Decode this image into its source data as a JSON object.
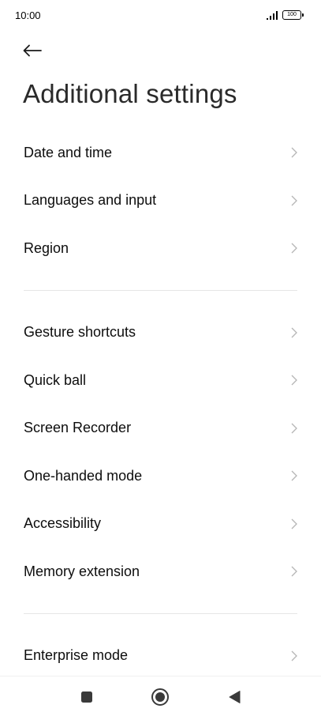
{
  "status_bar": {
    "time": "10:00",
    "battery": "100",
    "signal_icon": "signal-bars-icon",
    "battery_icon": "battery-icon"
  },
  "header": {
    "back_icon": "arrow-left-icon",
    "title": "Additional settings"
  },
  "groups": [
    {
      "items": [
        {
          "label": "Date and time"
        },
        {
          "label": "Languages and input"
        },
        {
          "label": "Region"
        }
      ]
    },
    {
      "items": [
        {
          "label": "Gesture shortcuts"
        },
        {
          "label": "Quick ball"
        },
        {
          "label": "Screen Recorder"
        },
        {
          "label": "One-handed mode"
        },
        {
          "label": "Accessibility"
        },
        {
          "label": "Memory extension"
        }
      ]
    },
    {
      "items": [
        {
          "label": "Enterprise mode"
        }
      ]
    }
  ],
  "nav_bar": {
    "recents_icon": "square-icon",
    "home_icon": "circle-icon",
    "back_icon": "triangle-back-icon"
  },
  "colors": {
    "background": "#ffffff",
    "text": "#0d0d0d",
    "chevron": "#b5b5b5",
    "divider": "#e6e6e6",
    "nav_icon": "#3a3a3a"
  }
}
